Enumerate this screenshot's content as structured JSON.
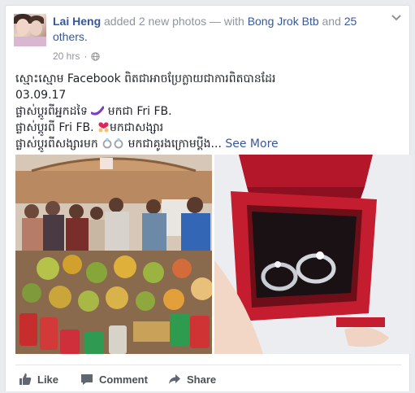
{
  "post": {
    "author": "Lai Heng",
    "action_text": " added 2 new photos — with ",
    "tagged_person": "Bong Jrok Btb",
    "and_text": " and ",
    "others_text": "25 others.",
    "timestamp": "20 hrs",
    "meta_separator": "·",
    "lines": [
      "ស្មោះស្មោម Facebook ពិតជាអាចប្រែក្លាយជាការពិតបានដែរ",
      "03.09.17"
    ],
    "line3_prefix": "ផ្លាស់ប្តូរពីអ្នកដទៃ ",
    "line3_suffix": " មកជា Fri FB.",
    "line4_prefix": "ផ្លាស់ប្តូរពី Fri FB. ",
    "line4_suffix": "មកជាសង្សារ",
    "line5_prefix": "ផ្លាស់ប្តូរពីសង្សារមក ",
    "line5_suffix": " មកជាគូរងក្រោមប្ដីង...",
    "see_more": "See More"
  },
  "actions": {
    "like": "Like",
    "comment": "Comment",
    "share": "Share"
  },
  "icons": [
    "globe-icon",
    "chevron-down-icon",
    "like-icon",
    "comment-icon",
    "share-icon"
  ],
  "colors": {
    "link": "#365899",
    "meta": "#90949c",
    "action_text": "#4b4f56",
    "background": "#e9ebee"
  }
}
